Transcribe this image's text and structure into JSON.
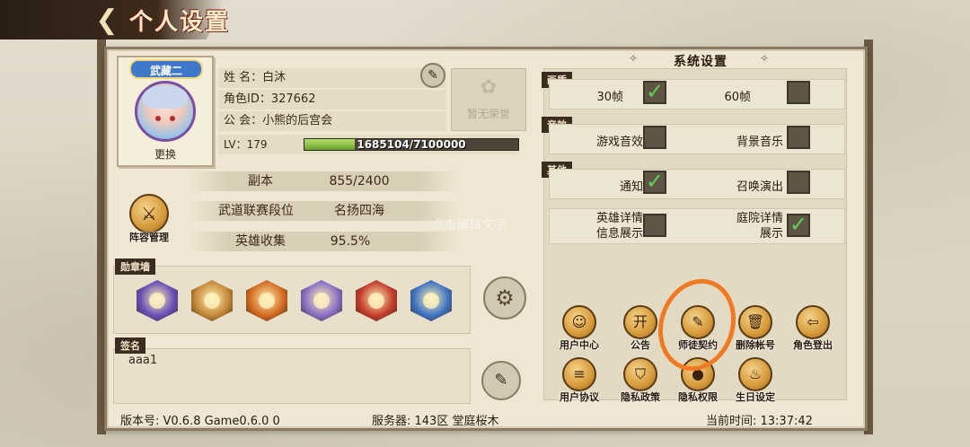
{
  "header": {
    "back_icon": "back-arrow-icon",
    "title": "个人设置"
  },
  "profile": {
    "avatar_tag": "武藏二",
    "change_label": "更换",
    "name_label": "姓  名：",
    "name": "白沐",
    "id_label": "角色ID：",
    "id": "327662",
    "guild_label": "公  会：",
    "guild": "小熊的后宫会",
    "honor_text": "暂无荣誉",
    "lv_label": "LV：",
    "lv": "179",
    "exp_text": "1685104/7100000",
    "exp_progress": 0.237
  },
  "stats": {
    "dungeon_label": "副本",
    "dungeon_value": "855/2400",
    "rank_label": "武道联赛段位",
    "rank_value": "名扬四海",
    "collect_label": "英雄收集",
    "collect_value": "95.5%"
  },
  "lineup": {
    "label": "阵容管理",
    "icon": "crossed-swords-icon"
  },
  "badges": {
    "title": "勋章墙",
    "items": [
      {
        "color": "#6a4fb8"
      },
      {
        "color": "#c58a3a"
      },
      {
        "color": "#d46a22"
      },
      {
        "color": "#8b6fc6"
      },
      {
        "color": "#c43c2c"
      },
      {
        "color": "#3f74c4"
      }
    ]
  },
  "signature": {
    "title": "签名",
    "text": "aaa1"
  },
  "footer": {
    "version": "版本号: V0.6.8 Game0.6.0 0",
    "server": "服务器: 143区 堂庭桜木",
    "time": "当前时间: 13:37:42"
  },
  "settings": {
    "title": "系统设置",
    "sections": {
      "quality": "画质",
      "sound": "音效",
      "other": "其他"
    },
    "fps30": {
      "label": "30帧",
      "checked": true
    },
    "fps60": {
      "label": "60帧",
      "checked": false
    },
    "game_sound": {
      "label": "游戏音效",
      "checked": false
    },
    "bgm": {
      "label": "背景音乐",
      "checked": false
    },
    "notify": {
      "label": "通知",
      "checked": true
    },
    "summon": {
      "label": "召唤演出",
      "checked": false
    },
    "hero_detail": {
      "label_line1": "英雄详情",
      "label_line2": "信息展示",
      "checked": false
    },
    "yard_detail": {
      "label_line1": "庭院详情",
      "label_line2": "展示",
      "checked": true
    }
  },
  "watermark": "点击编辑文字",
  "actions": [
    {
      "label": "用户中心",
      "icon": "user-center-icon",
      "glyph": "☺"
    },
    {
      "label": "公告",
      "icon": "announcement-icon",
      "glyph": "开"
    },
    {
      "label": "师徒契约",
      "icon": "contract-icon",
      "glyph": "✎"
    },
    {
      "label": "删除帐号",
      "icon": "trash-icon",
      "glyph": "🗑"
    },
    {
      "label": "角色登出",
      "icon": "logout-icon",
      "glyph": "⇦"
    },
    {
      "label": "用户协议",
      "icon": "document-icon",
      "glyph": "≡"
    },
    {
      "label": "隐私政策",
      "icon": "shield-icon",
      "glyph": "⛉"
    },
    {
      "label": "隐私权限",
      "icon": "permission-icon",
      "glyph": "●"
    },
    {
      "label": "生日设定",
      "icon": "cake-icon",
      "glyph": "♨"
    }
  ]
}
